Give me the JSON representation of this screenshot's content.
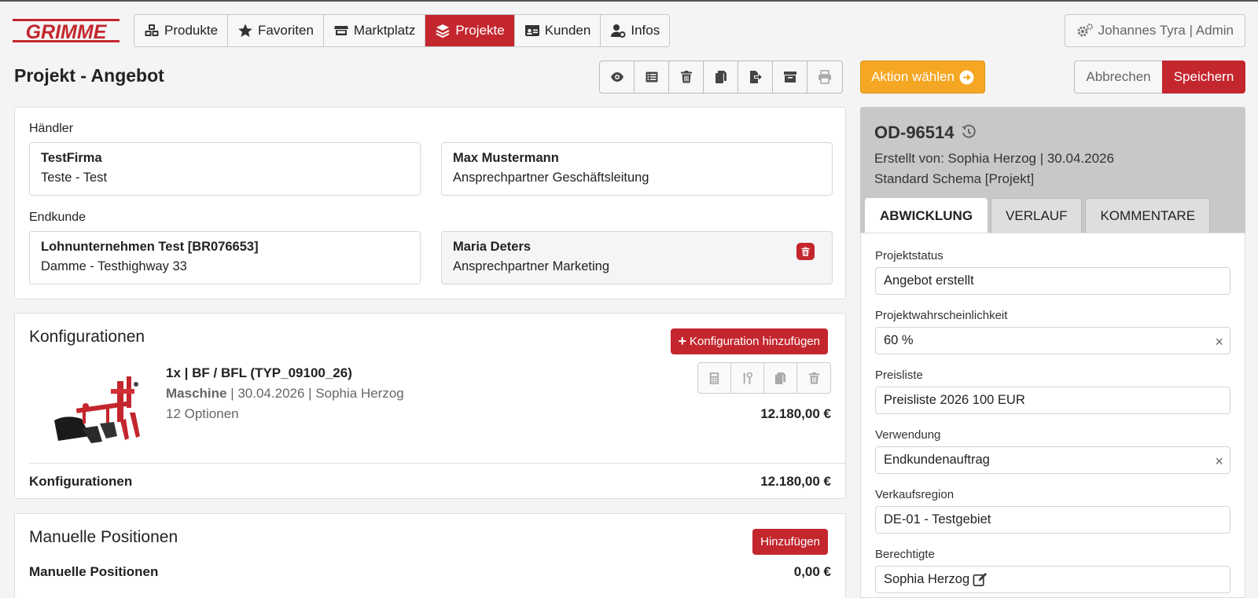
{
  "header": {
    "logo_text": "GRIMME",
    "nav": [
      {
        "label": "Produkte",
        "icon": "cubes-icon",
        "active": false
      },
      {
        "label": "Favoriten",
        "icon": "star-icon",
        "active": false
      },
      {
        "label": "Marktplatz",
        "icon": "store-icon",
        "active": false
      },
      {
        "label": "Projekte",
        "icon": "layers-icon",
        "active": true
      },
      {
        "label": "Kunden",
        "icon": "id-card-icon",
        "active": false
      },
      {
        "label": "Infos",
        "icon": "user-cog-icon",
        "active": false
      }
    ],
    "user": "Johannes Tyra | Admin"
  },
  "title_row": {
    "title": "Projekt - Angebot",
    "toolbar_icons": [
      "eye-icon",
      "list-icon",
      "trash-icon",
      "copy-icon",
      "export-icon",
      "archive-icon",
      "print-icon"
    ],
    "aktion_label": "Aktion wählen",
    "abbrechen_label": "Abbrechen",
    "speichern_label": "Speichern"
  },
  "haendler": {
    "label": "Händler",
    "company": {
      "name": "TestFirma",
      "sub": "Teste - Test"
    },
    "contact": {
      "name": "Max Mustermann",
      "sub": "Ansprechpartner Geschäftsleitung"
    }
  },
  "endkunde": {
    "label": "Endkunde",
    "company": {
      "name": "Lohnunternehmen Test [BR076653]",
      "sub": "Damme - Testhighway 33"
    },
    "contact": {
      "name": "Maria Deters",
      "sub": "Ansprechpartner Marketing"
    }
  },
  "konfigurationen": {
    "title": "Konfigurationen",
    "add_label": "Konfiguration hinzufügen",
    "item": {
      "title": "1x | BF / BFL (TYP_09100_26)",
      "type": "Maschine",
      "meta": " | 30.04.2026 | Sophia Herzog",
      "options": "12 Optionen",
      "price": "12.180,00 €"
    },
    "sum_label": "Konfigurationen",
    "sum_value": "12.180,00 €"
  },
  "manuelle": {
    "title": "Manuelle Positionen",
    "add_label": "Hinzufügen",
    "sum_label": "Manuelle Positionen",
    "sum_value": "0,00 €"
  },
  "right": {
    "order_no": "OD-96514",
    "created": "Erstellt von: Sophia Herzog | 30.04.2026",
    "schema": "Standard Schema [Projekt]",
    "tabs": [
      "ABWICKLUNG",
      "VERLAUF",
      "KOMMENTARE"
    ],
    "fields": [
      {
        "label": "Projektstatus",
        "value": "Angebot erstellt"
      },
      {
        "label": "Projektwahrscheinlichkeit",
        "value": "60 %"
      },
      {
        "label": "Preisliste",
        "value": "Preisliste 2026 100 EUR"
      },
      {
        "label": "Verwendung",
        "value": "Endkundenauftrag"
      },
      {
        "label": "Verkaufsregion",
        "value": "DE-01 - Testgebiet"
      },
      {
        "label": "Berechtigte",
        "value": "Sophia Herzog"
      }
    ],
    "clear_symbol": "×"
  },
  "colors": {
    "brand_red": "#c4262e",
    "action_orange": "#f5a623"
  }
}
